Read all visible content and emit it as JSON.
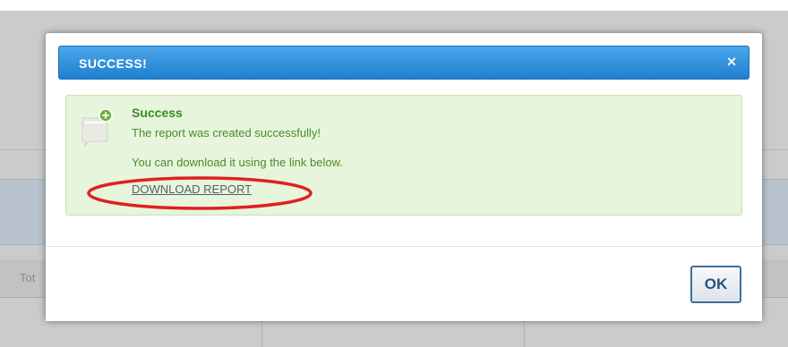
{
  "background": {
    "header_text": "Tot"
  },
  "modal": {
    "title": "SUCCESS!",
    "close_glyph": "×",
    "alert": {
      "icon": "message-plus-icon",
      "title": "Success",
      "message_line1": "The report was created successfully!",
      "message_line2": "You can download it using the link below.",
      "link_label": "DOWNLOAD REPORT"
    },
    "ok_label": "OK"
  },
  "colors": {
    "header_blue": "#2f8fdc",
    "alert_bg": "#e6f5dc",
    "alert_text": "#4a8b2c",
    "highlight_red": "#e02020"
  }
}
